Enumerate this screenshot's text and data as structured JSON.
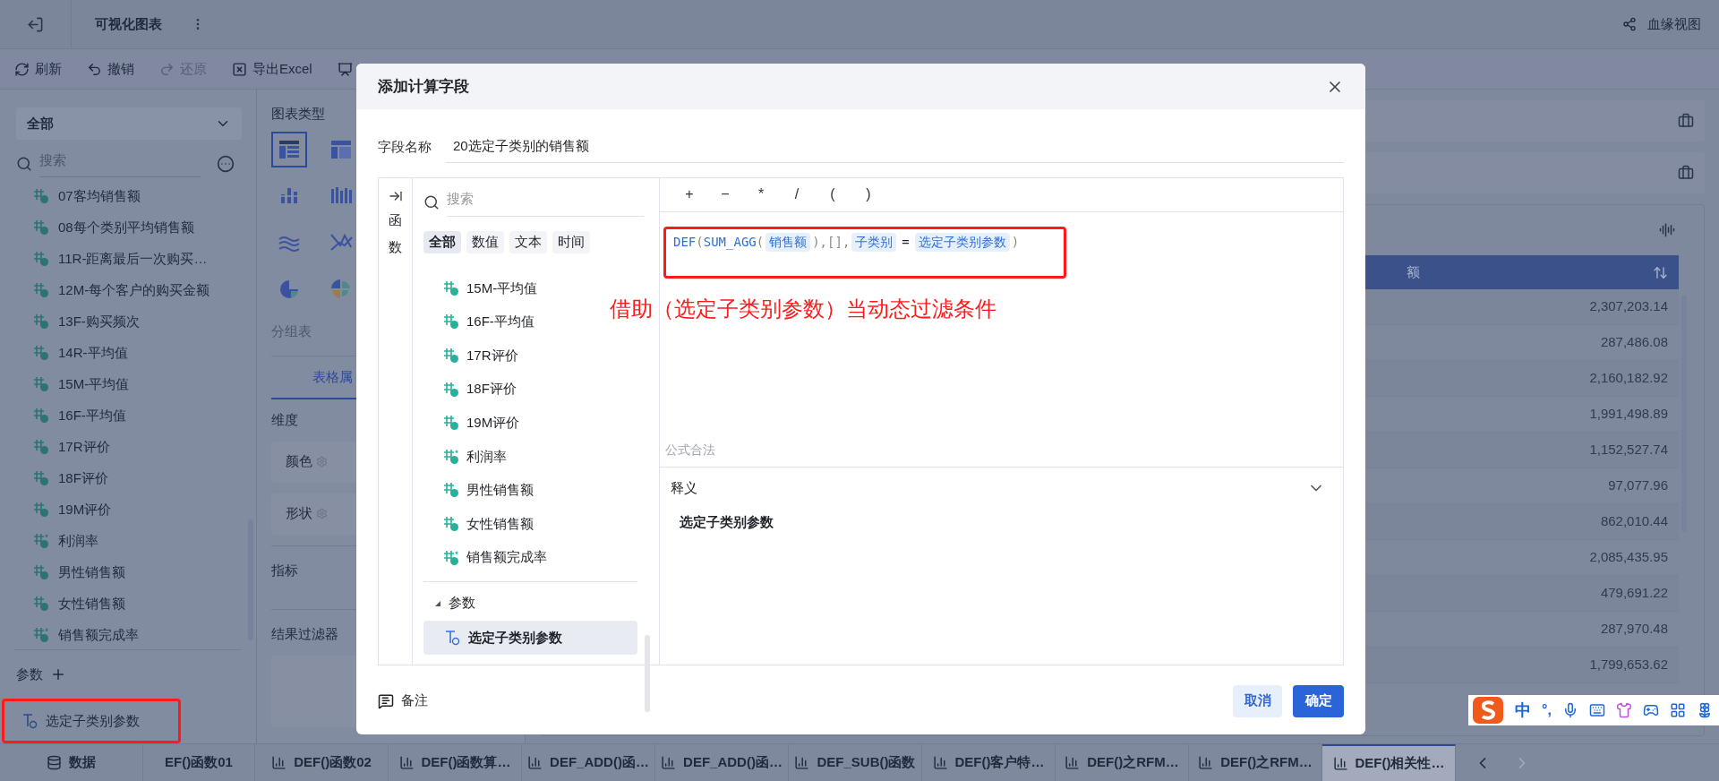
{
  "app_bar": {
    "title": "可视化图表",
    "lineage": "血缘视图"
  },
  "toolbar": [
    {
      "label": "刷新",
      "kind": "refresh",
      "disabled": false
    },
    {
      "label": "撤销",
      "kind": "undo",
      "disabled": false
    },
    {
      "label": "还原",
      "kind": "redo",
      "disabled": true
    },
    {
      "label": "导出Excel",
      "kind": "export",
      "disabled": false
    },
    {
      "kind": "data",
      "disabled": false
    }
  ],
  "field_panel": {
    "scope": "全部",
    "search_placeholder": "搜索",
    "fields": [
      {
        "name": "07客均销售额",
        "kind": "field"
      },
      {
        "name": "08每个类别平均销售额",
        "kind": "field"
      },
      {
        "name": "11R-距离最后一次购买…",
        "kind": "field"
      },
      {
        "name": "12M-每个客户的购买金额",
        "kind": "field"
      },
      {
        "name": "13F-购买频次",
        "kind": "field"
      },
      {
        "name": "14R-平均值",
        "kind": "field"
      },
      {
        "name": "15M-平均值",
        "kind": "field"
      },
      {
        "name": "16F-平均值",
        "kind": "field"
      },
      {
        "name": "17R评价",
        "kind": "field"
      },
      {
        "name": "18F评价",
        "kind": "field"
      },
      {
        "name": "19M评价",
        "kind": "field"
      },
      {
        "name": "利润率",
        "kind": "calc"
      },
      {
        "name": "男性销售额",
        "kind": "field"
      },
      {
        "name": "女性销售额",
        "kind": "field"
      },
      {
        "name": "销售额完成率",
        "kind": "calc"
      }
    ],
    "params_title": "参数",
    "params": [
      {
        "name": "选定子类别参数"
      }
    ]
  },
  "chart_panel": {
    "title": "图表类型",
    "chart_types": [
      {
        "kind": "table",
        "selected": true
      },
      {
        "kind": "crosstab",
        "selected": false
      },
      {
        "kind": "bar",
        "selected": false
      },
      {
        "kind": "columns",
        "selected": false
      },
      {
        "kind": "area",
        "selected": false
      },
      {
        "kind": "line",
        "selected": false
      },
      {
        "kind": "pie",
        "selected": false
      },
      {
        "kind": "rose",
        "selected": false
      }
    ],
    "chart_name": "分组表",
    "tab": "表格属",
    "dimension_title": "维度",
    "slots": [
      "颜色",
      "形状"
    ],
    "measure_title": "指标",
    "filter_title": "结果过滤器"
  },
  "table": {
    "header": "额",
    "values": [
      "2,307,203.14",
      "287,486.08",
      "2,160,182.92",
      "1,991,498.89",
      "1,152,527.74",
      "97,077.96",
      "862,010.44",
      "2,085,435.95",
      "479,691.22",
      "287,970.48",
      "1,799,653.62"
    ]
  },
  "dialog": {
    "title": "添加计算字段",
    "name_label": "字段名称",
    "name_value": "20选定子类别的销售额",
    "side_tab": [
      "函",
      "数"
    ],
    "search_placeholder": "搜索",
    "categories": [
      {
        "label": "全部",
        "selected": true
      },
      {
        "label": "数值",
        "selected": false
      },
      {
        "label": "文本",
        "selected": false
      },
      {
        "label": "时间",
        "selected": false
      }
    ],
    "fields": [
      {
        "name": "15M-平均值",
        "kind": "field"
      },
      {
        "name": "16F-平均值",
        "kind": "field"
      },
      {
        "name": "17R评价",
        "kind": "field"
      },
      {
        "name": "18F评价",
        "kind": "field"
      },
      {
        "name": "19M评价",
        "kind": "field"
      },
      {
        "name": "利润率",
        "kind": "calc"
      },
      {
        "name": "男性销售额",
        "kind": "field"
      },
      {
        "name": "女性销售额",
        "kind": "field"
      },
      {
        "name": "销售额完成率",
        "kind": "calc"
      }
    ],
    "params_group": "参数",
    "params": [
      {
        "name": "选定子类别参数",
        "selected": true
      }
    ],
    "operators": [
      "+",
      "−",
      "*",
      "/",
      "(",
      ")"
    ],
    "formula": [
      {
        "kind": "func",
        "text": "DEF"
      },
      {
        "kind": "punct",
        "text": "("
      },
      {
        "kind": "func",
        "text": "SUM_AGG"
      },
      {
        "kind": "punct",
        "text": "("
      },
      {
        "kind": "field",
        "text": "销售额"
      },
      {
        "kind": "punct",
        "text": "),[],"
      },
      {
        "kind": "field",
        "text": "子类别"
      },
      {
        "kind": "op",
        "text": "="
      },
      {
        "kind": "field",
        "text": "选定子类别参数"
      },
      {
        "kind": "punct",
        "text": ")"
      }
    ],
    "status": "公式合法",
    "explain_title": "释义",
    "explain_text": "选定子类别参数",
    "note": "备注",
    "cancel": "取消",
    "ok": "确定"
  },
  "annotation": "借助（选定子类别参数）当动态过滤条件",
  "bottom_tabs": [
    {
      "label": "数据",
      "kind": "data",
      "selected": false
    },
    {
      "label": "EF()函数01",
      "kind": "cut",
      "selected": false
    },
    {
      "label": "DEF()函数02",
      "kind": "chart",
      "selected": false
    },
    {
      "label": "DEF()函数算…",
      "kind": "chart",
      "selected": false
    },
    {
      "label": "DEF_ADD()函…",
      "kind": "chart",
      "selected": false
    },
    {
      "label": "DEF_ADD()函…",
      "kind": "chart",
      "selected": false
    },
    {
      "label": "DEF_SUB()函数",
      "kind": "chart",
      "selected": false
    },
    {
      "label": "DEF()客户特…",
      "kind": "chart",
      "selected": false
    },
    {
      "label": "DEF()之RFM…",
      "kind": "chart",
      "selected": false
    },
    {
      "label": "DEF()之RFM…",
      "kind": "chart",
      "selected": false
    },
    {
      "label": "DEF()相关性…",
      "kind": "chart",
      "selected": true
    }
  ],
  "ime": {
    "mode": "中",
    "punct": "°,"
  }
}
